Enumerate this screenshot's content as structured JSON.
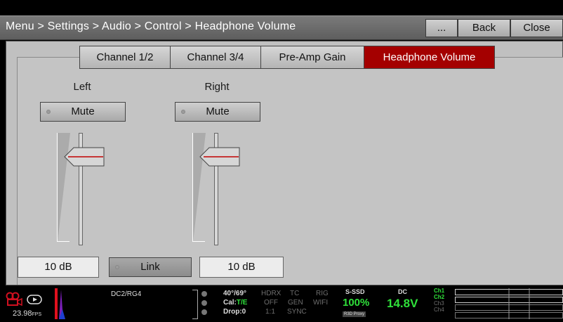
{
  "header": {
    "breadcrumb": "Menu > Settings > Audio > Control > Headphone Volume",
    "more_label": "...",
    "back_label": "Back",
    "close_label": "Close"
  },
  "tabs": [
    {
      "label": "Channel 1/2",
      "active": false
    },
    {
      "label": "Channel 3/4",
      "active": false
    },
    {
      "label": "Pre-Amp Gain",
      "active": false
    },
    {
      "label": "Headphone Volume",
      "active": true
    }
  ],
  "left": {
    "label": "Left",
    "mute_label": "Mute",
    "value": "10 dB",
    "level": 0.85
  },
  "right": {
    "label": "Right",
    "mute_label": "Mute",
    "value": "10 dB",
    "level": 0.85
  },
  "link_label": "Link",
  "status": {
    "fps": "23.98",
    "fps_unit": "FPS",
    "look": "DC2/RG4",
    "temp": "40°/69°",
    "cal_label": "Cal:",
    "cal_value": "T/E",
    "drop": "Drop:0",
    "hdrx": "HDRX",
    "hdrx_state": "OFF",
    "ratio": "1:1",
    "tc": "TC",
    "tc_state": "GEN",
    "rig": "RIG",
    "rig_state": "WIFI",
    "sync": "SYNC",
    "media_label": "S-SSD",
    "media_value": "100%",
    "media_badges": "R3D Proxy",
    "power_label": "DC",
    "power_value": "14.8V",
    "channels": [
      "Ch1",
      "Ch2",
      "Ch3",
      "Ch4"
    ]
  },
  "colors": {
    "accent": "#a40000",
    "status_green": "#2fe03a"
  }
}
